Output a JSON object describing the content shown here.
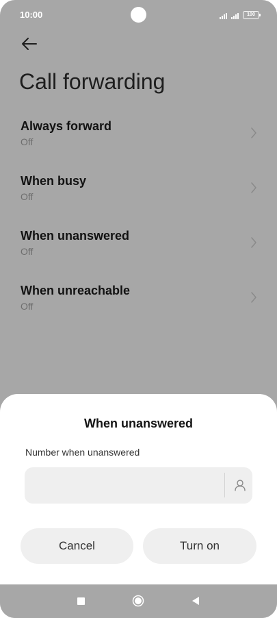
{
  "status_bar": {
    "time": "10:00",
    "battery": "100"
  },
  "header": {
    "title": "Call forwarding"
  },
  "settings": [
    {
      "title": "Always forward",
      "status": "Off"
    },
    {
      "title": "When busy",
      "status": "Off"
    },
    {
      "title": "When unanswered",
      "status": "Off"
    },
    {
      "title": "When unreachable",
      "status": "Off"
    }
  ],
  "dialog": {
    "title": "When unanswered",
    "field_label": "Number when unanswered",
    "field_value": "",
    "cancel_label": "Cancel",
    "confirm_label": "Turn on"
  },
  "colors": {
    "dim_background": "#a7a7a7",
    "sheet_background": "#ffffff",
    "button_background": "#efefef"
  },
  "icons": [
    "back-arrow-icon",
    "chevron-right-icon",
    "contact-icon",
    "recents-icon",
    "home-icon",
    "back-icon"
  ]
}
